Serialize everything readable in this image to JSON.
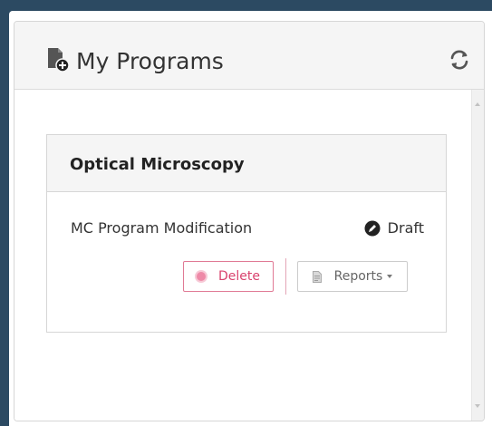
{
  "panel": {
    "title": "My Programs",
    "header_icon": "file-plus-icon",
    "refresh_icon": "refresh-icon"
  },
  "card": {
    "title": "Optical Microscopy",
    "program_name": "MC Program Modification",
    "status": "Draft",
    "status_icon": "draft-pencil-icon",
    "actions": {
      "delete_label": "Delete",
      "delete_icon": "delete-dot-icon",
      "reports_label": "Reports",
      "reports_icon": "document-icon"
    }
  },
  "colors": {
    "frame_border": "#2c4a62",
    "delete_accent": "#d9436e",
    "panel_header_bg": "#f5f5f5"
  }
}
